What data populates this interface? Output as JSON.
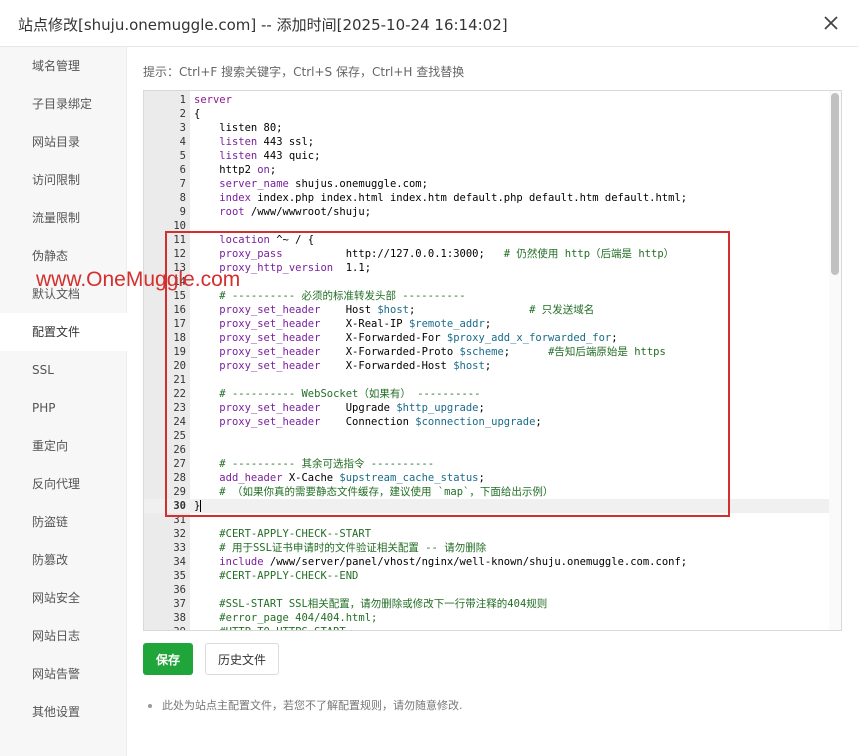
{
  "window": {
    "title": "站点修改[shuju.onemuggle.com] -- 添加时间[2025-10-24 16:14:02]",
    "close_icon": "close-icon"
  },
  "sidebar": {
    "items": [
      {
        "label": "域名管理"
      },
      {
        "label": "子目录绑定"
      },
      {
        "label": "网站目录"
      },
      {
        "label": "访问限制"
      },
      {
        "label": "流量限制"
      },
      {
        "label": "伪静态"
      },
      {
        "label": "默认文档"
      },
      {
        "label": "配置文件",
        "active": true
      },
      {
        "label": "SSL"
      },
      {
        "label": "PHP"
      },
      {
        "label": "重定向"
      },
      {
        "label": "反向代理"
      },
      {
        "label": "防盗链"
      },
      {
        "label": "防篡改"
      },
      {
        "label": "网站安全"
      },
      {
        "label": "网站日志"
      },
      {
        "label": "网站告警"
      },
      {
        "label": "其他设置"
      }
    ]
  },
  "tip": "提示：Ctrl+F 搜索关键字，Ctrl+S 保存，Ctrl+H 查找替换",
  "editor": {
    "current_line": 30,
    "lines": [
      {
        "n": "1",
        "parts": [
          [
            "kw",
            "server"
          ]
        ]
      },
      {
        "n": "2",
        "parts": [
          [
            "plain",
            "{"
          ]
        ]
      },
      {
        "n": "3",
        "parts": [
          [
            "plain",
            "    listen 80;"
          ]
        ]
      },
      {
        "n": "4",
        "parts": [
          [
            "plain",
            "    "
          ],
          [
            "key",
            "listen"
          ],
          [
            "plain",
            " 443 ssl;"
          ]
        ]
      },
      {
        "n": "5",
        "parts": [
          [
            "plain",
            "    "
          ],
          [
            "key",
            "listen"
          ],
          [
            "plain",
            " 443 quic;"
          ]
        ]
      },
      {
        "n": "6",
        "parts": [
          [
            "plain",
            "    http2 "
          ],
          [
            "key",
            "on"
          ],
          [
            "plain",
            ";"
          ]
        ]
      },
      {
        "n": "7",
        "parts": [
          [
            "plain",
            "    "
          ],
          [
            "key",
            "server_name"
          ],
          [
            "plain",
            " shujus.onemuggle.com;"
          ]
        ]
      },
      {
        "n": "8",
        "parts": [
          [
            "plain",
            "    "
          ],
          [
            "key",
            "index"
          ],
          [
            "plain",
            " index.php index.html index.htm default.php default.htm default.html;"
          ]
        ]
      },
      {
        "n": "9",
        "parts": [
          [
            "plain",
            "    "
          ],
          [
            "key",
            "root"
          ],
          [
            "plain",
            " /www/wwwroot/shuju;"
          ]
        ]
      },
      {
        "n": "10",
        "parts": []
      },
      {
        "n": "11",
        "parts": [
          [
            "plain",
            "    "
          ],
          [
            "key",
            "location"
          ],
          [
            "plain",
            " ^~ / {"
          ]
        ]
      },
      {
        "n": "12",
        "parts": [
          [
            "plain",
            "    "
          ],
          [
            "key",
            "proxy_pass"
          ],
          [
            "plain",
            "          http://127.0.0.1:3000;   "
          ],
          [
            "cm",
            "# 仍然使用 http（后端是 http）"
          ]
        ]
      },
      {
        "n": "13",
        "parts": [
          [
            "plain",
            "    "
          ],
          [
            "key",
            "proxy_http_version"
          ],
          [
            "plain",
            "  1.1;"
          ]
        ]
      },
      {
        "n": "14",
        "parts": []
      },
      {
        "n": "15",
        "parts": [
          [
            "plain",
            "    "
          ],
          [
            "cm",
            "# ---------- 必须的标准转发头部 ----------"
          ]
        ]
      },
      {
        "n": "16",
        "parts": [
          [
            "plain",
            "    "
          ],
          [
            "key",
            "proxy_set_header"
          ],
          [
            "plain",
            "    Host "
          ],
          [
            "var",
            "$host"
          ],
          [
            "plain",
            ";                  "
          ],
          [
            "cm",
            "# 只发送域名"
          ]
        ]
      },
      {
        "n": "17",
        "parts": [
          [
            "plain",
            "    "
          ],
          [
            "key",
            "proxy_set_header"
          ],
          [
            "plain",
            "    X-Real-IP "
          ],
          [
            "var",
            "$remote_addr"
          ],
          [
            "plain",
            ";"
          ]
        ]
      },
      {
        "n": "18",
        "parts": [
          [
            "plain",
            "    "
          ],
          [
            "key",
            "proxy_set_header"
          ],
          [
            "plain",
            "    X-Forwarded-For "
          ],
          [
            "var",
            "$proxy_add_x_forwarded_for"
          ],
          [
            "plain",
            ";"
          ]
        ]
      },
      {
        "n": "19",
        "parts": [
          [
            "plain",
            "    "
          ],
          [
            "key",
            "proxy_set_header"
          ],
          [
            "plain",
            "    X-Forwarded-Proto "
          ],
          [
            "var",
            "$scheme"
          ],
          [
            "plain",
            ";      "
          ],
          [
            "cm",
            "#告知后端原始是 https"
          ]
        ]
      },
      {
        "n": "20",
        "parts": [
          [
            "plain",
            "    "
          ],
          [
            "key",
            "proxy_set_header"
          ],
          [
            "plain",
            "    X-Forwarded-Host "
          ],
          [
            "var",
            "$host"
          ],
          [
            "plain",
            ";"
          ]
        ]
      },
      {
        "n": "21",
        "parts": []
      },
      {
        "n": "22",
        "parts": [
          [
            "plain",
            "    "
          ],
          [
            "cm",
            "# ---------- WebSocket（如果有） ----------"
          ]
        ]
      },
      {
        "n": "23",
        "parts": [
          [
            "plain",
            "    "
          ],
          [
            "key",
            "proxy_set_header"
          ],
          [
            "plain",
            "    Upgrade "
          ],
          [
            "var",
            "$http_upgrade"
          ],
          [
            "plain",
            ";"
          ]
        ]
      },
      {
        "n": "24",
        "parts": [
          [
            "plain",
            "    "
          ],
          [
            "key",
            "proxy_set_header"
          ],
          [
            "plain",
            "    Connection "
          ],
          [
            "var",
            "$connection_upgrade"
          ],
          [
            "plain",
            ";"
          ]
        ]
      },
      {
        "n": "25",
        "parts": []
      },
      {
        "n": "26",
        "parts": []
      },
      {
        "n": "27",
        "parts": [
          [
            "plain",
            "    "
          ],
          [
            "cm",
            "# ---------- 其余可选指令 ----------"
          ]
        ]
      },
      {
        "n": "28",
        "parts": [
          [
            "plain",
            "    "
          ],
          [
            "key",
            "add_header"
          ],
          [
            "plain",
            " X-Cache "
          ],
          [
            "var",
            "$upstream_cache_status"
          ],
          [
            "plain",
            ";"
          ]
        ]
      },
      {
        "n": "29",
        "parts": [
          [
            "plain",
            "    "
          ],
          [
            "cm",
            "# （如果你真的需要静态文件缓存，建议使用 `map`，下面给出示例）"
          ]
        ]
      },
      {
        "n": "30",
        "parts": [
          [
            "plain",
            "}"
          ]
        ]
      },
      {
        "n": "31",
        "parts": []
      },
      {
        "n": "32",
        "parts": [
          [
            "plain",
            "    "
          ],
          [
            "cm",
            "#CERT-APPLY-CHECK--START"
          ]
        ]
      },
      {
        "n": "33",
        "parts": [
          [
            "plain",
            "    "
          ],
          [
            "cm",
            "# 用于SSL证书申请时的文件验证相关配置 -- 请勿删除"
          ]
        ]
      },
      {
        "n": "34",
        "parts": [
          [
            "plain",
            "    "
          ],
          [
            "key",
            "include"
          ],
          [
            "plain",
            " /www/server/panel/vhost/nginx/well-known/shuju.onemuggle.com.conf;"
          ]
        ]
      },
      {
        "n": "35",
        "parts": [
          [
            "plain",
            "    "
          ],
          [
            "cm",
            "#CERT-APPLY-CHECK--END"
          ]
        ]
      },
      {
        "n": "36",
        "parts": []
      },
      {
        "n": "37",
        "parts": [
          [
            "plain",
            "    "
          ],
          [
            "cm",
            "#SSL-START SSL相关配置，请勿删除或修改下一行带注释的404规则"
          ]
        ]
      },
      {
        "n": "38",
        "parts": [
          [
            "plain",
            "    "
          ],
          [
            "cm",
            "#error_page 404/404.html;"
          ]
        ]
      },
      {
        "n": "39",
        "parts": [
          [
            "plain",
            "    "
          ],
          [
            "cm",
            "#HTTP_TO_HTTPS_START"
          ]
        ]
      }
    ]
  },
  "buttons": {
    "save": "保存",
    "history": "历史文件"
  },
  "note": "此处为站点主配置文件，若您不了解配置规则，请勿随意修改.",
  "watermark": "www.OneMuggle.com",
  "colors": {
    "accent": "#20a53a",
    "highlight_border": "#d32f2f",
    "keyword": "#8b1a8b",
    "directive": "#7a1f9e",
    "variable": "#1a6b8a",
    "comment": "#236e25"
  }
}
